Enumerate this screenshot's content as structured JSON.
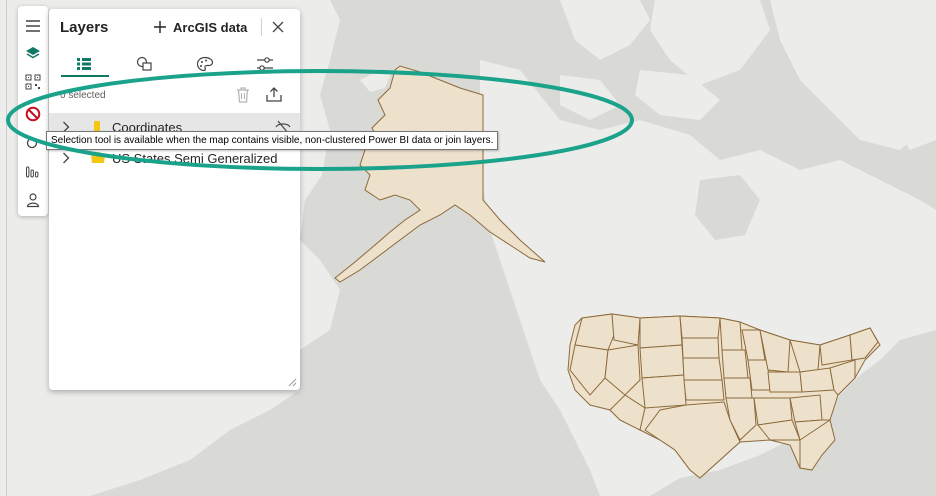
{
  "panel": {
    "title": "Layers",
    "add_data_label": "ArcGIS data",
    "selected_count": "0 selected",
    "tabs": [
      {
        "name": "layer-list",
        "icon": "layer-list-icon",
        "active": true
      },
      {
        "name": "shapes",
        "icon": "shapes-icon",
        "active": false
      },
      {
        "name": "style",
        "icon": "palette-icon",
        "active": false
      },
      {
        "name": "filter",
        "icon": "sliders-icon",
        "active": false
      }
    ],
    "layers": [
      {
        "name": "Coordinates",
        "icon": "point-layer-icon",
        "highlighted": true
      },
      {
        "name": "US States Semi Generalized",
        "icon": "polygon-layer-icon",
        "highlighted": false
      }
    ]
  },
  "rail": {
    "items": [
      "menu-icon",
      "layers-icon",
      "qr-grid-icon",
      "selection-disabled-icon",
      "search-location-icon",
      "analysis-icon",
      "person-icon"
    ]
  },
  "tooltip": {
    "text": "Selection tool is available when the map contains visible, non-clustered Power BI data or join layers."
  },
  "colors": {
    "accent": "#117865",
    "annotation": "#1aa38a",
    "land": "#ececea",
    "water": "#d9d9d6",
    "states_fill": "#eee1cc",
    "states_stroke": "#8c6a3a",
    "disabled_red": "#c50f1f"
  }
}
